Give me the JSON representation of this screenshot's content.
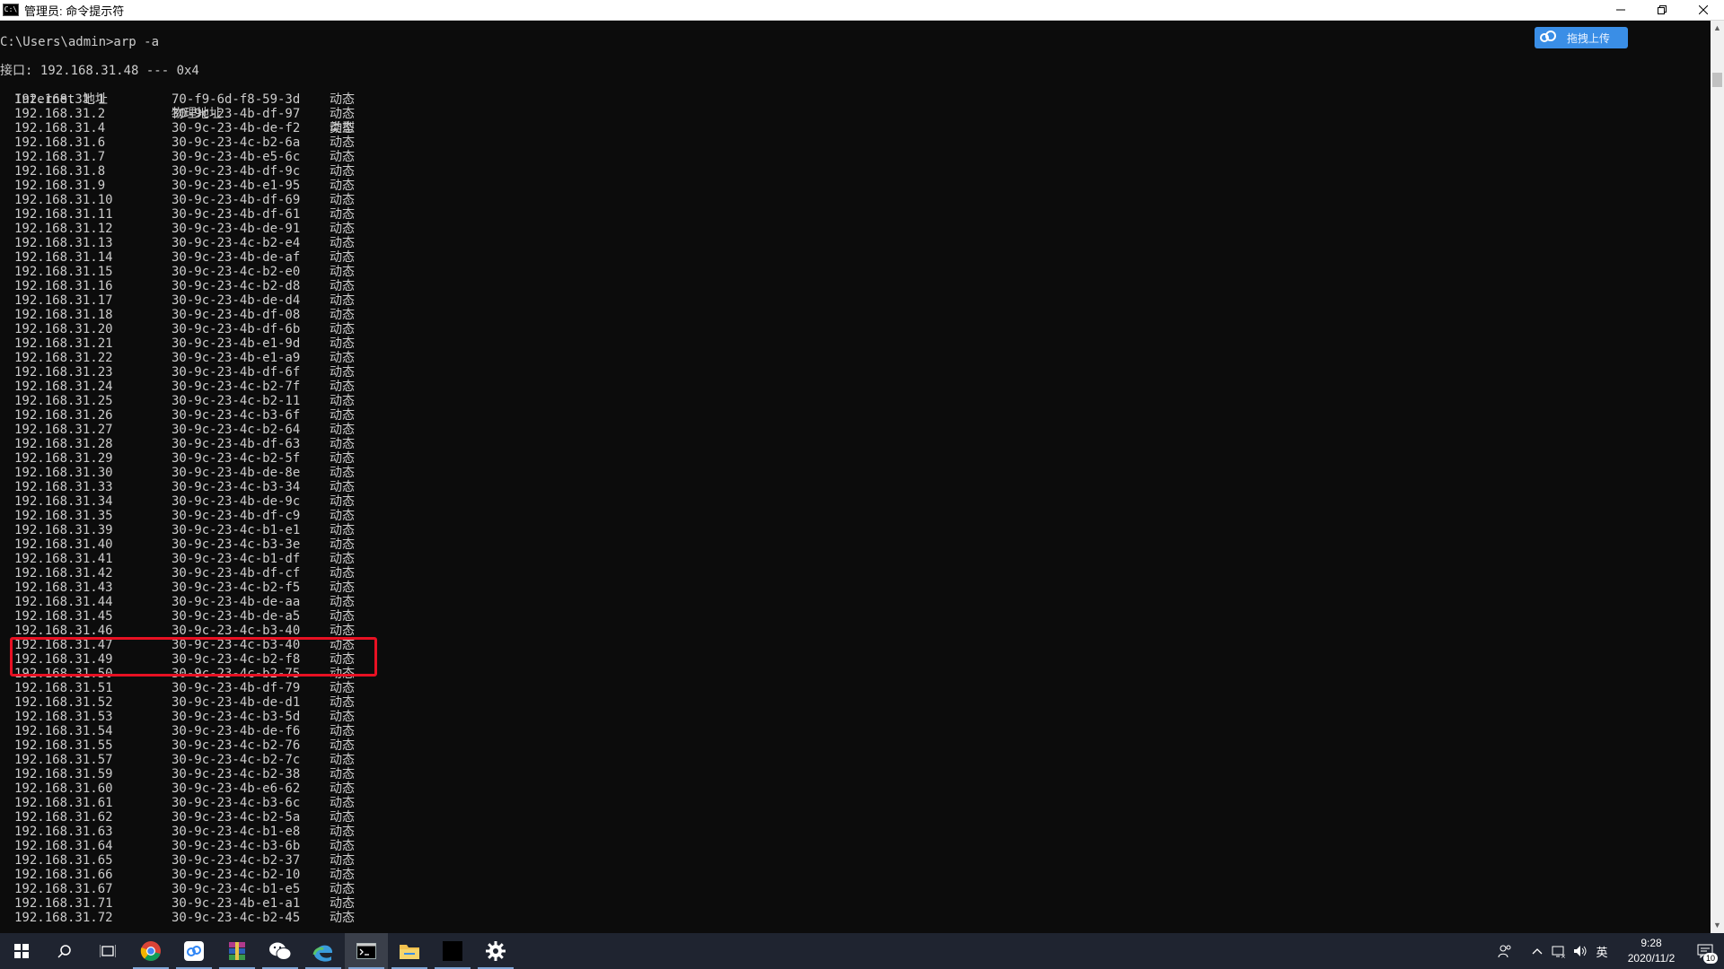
{
  "window": {
    "title": "管理员: 命令提示符",
    "app_icon_text": "C:\\"
  },
  "console": {
    "prompt": "C:\\Users\\admin>arp -a",
    "interface_line": "接口: 192.168.31.48 --- 0x4",
    "headers": [
      "Internet 地址",
      "物理地址",
      "类型"
    ],
    "rows": [
      {
        "ip": "192.168.31.1",
        "mac": "70-f9-6d-f8-59-3d",
        "type": "动态"
      },
      {
        "ip": "192.168.31.2",
        "mac": "30-9c-23-4b-df-97",
        "type": "动态"
      },
      {
        "ip": "192.168.31.4",
        "mac": "30-9c-23-4b-de-f2",
        "type": "动态"
      },
      {
        "ip": "192.168.31.6",
        "mac": "30-9c-23-4c-b2-6a",
        "type": "动态"
      },
      {
        "ip": "192.168.31.7",
        "mac": "30-9c-23-4b-e5-6c",
        "type": "动态"
      },
      {
        "ip": "192.168.31.8",
        "mac": "30-9c-23-4b-df-9c",
        "type": "动态"
      },
      {
        "ip": "192.168.31.9",
        "mac": "30-9c-23-4b-e1-95",
        "type": "动态"
      },
      {
        "ip": "192.168.31.10",
        "mac": "30-9c-23-4b-df-69",
        "type": "动态"
      },
      {
        "ip": "192.168.31.11",
        "mac": "30-9c-23-4b-df-61",
        "type": "动态"
      },
      {
        "ip": "192.168.31.12",
        "mac": "30-9c-23-4b-de-91",
        "type": "动态"
      },
      {
        "ip": "192.168.31.13",
        "mac": "30-9c-23-4c-b2-e4",
        "type": "动态"
      },
      {
        "ip": "192.168.31.14",
        "mac": "30-9c-23-4b-de-af",
        "type": "动态"
      },
      {
        "ip": "192.168.31.15",
        "mac": "30-9c-23-4c-b2-e0",
        "type": "动态"
      },
      {
        "ip": "192.168.31.16",
        "mac": "30-9c-23-4c-b2-d8",
        "type": "动态"
      },
      {
        "ip": "192.168.31.17",
        "mac": "30-9c-23-4b-de-d4",
        "type": "动态"
      },
      {
        "ip": "192.168.31.18",
        "mac": "30-9c-23-4b-df-08",
        "type": "动态"
      },
      {
        "ip": "192.168.31.20",
        "mac": "30-9c-23-4b-df-6b",
        "type": "动态"
      },
      {
        "ip": "192.168.31.21",
        "mac": "30-9c-23-4b-e1-9d",
        "type": "动态"
      },
      {
        "ip": "192.168.31.22",
        "mac": "30-9c-23-4b-e1-a9",
        "type": "动态"
      },
      {
        "ip": "192.168.31.23",
        "mac": "30-9c-23-4b-df-6f",
        "type": "动态"
      },
      {
        "ip": "192.168.31.24",
        "mac": "30-9c-23-4c-b2-7f",
        "type": "动态"
      },
      {
        "ip": "192.168.31.25",
        "mac": "30-9c-23-4c-b2-11",
        "type": "动态"
      },
      {
        "ip": "192.168.31.26",
        "mac": "30-9c-23-4c-b3-6f",
        "type": "动态"
      },
      {
        "ip": "192.168.31.27",
        "mac": "30-9c-23-4c-b2-64",
        "type": "动态"
      },
      {
        "ip": "192.168.31.28",
        "mac": "30-9c-23-4b-df-63",
        "type": "动态"
      },
      {
        "ip": "192.168.31.29",
        "mac": "30-9c-23-4c-b2-5f",
        "type": "动态"
      },
      {
        "ip": "192.168.31.30",
        "mac": "30-9c-23-4b-de-8e",
        "type": "动态"
      },
      {
        "ip": "192.168.31.33",
        "mac": "30-9c-23-4c-b3-34",
        "type": "动态"
      },
      {
        "ip": "192.168.31.34",
        "mac": "30-9c-23-4b-de-9c",
        "type": "动态"
      },
      {
        "ip": "192.168.31.35",
        "mac": "30-9c-23-4b-df-c9",
        "type": "动态"
      },
      {
        "ip": "192.168.31.39",
        "mac": "30-9c-23-4c-b1-e1",
        "type": "动态"
      },
      {
        "ip": "192.168.31.40",
        "mac": "30-9c-23-4c-b3-3e",
        "type": "动态"
      },
      {
        "ip": "192.168.31.41",
        "mac": "30-9c-23-4c-b1-df",
        "type": "动态"
      },
      {
        "ip": "192.168.31.42",
        "mac": "30-9c-23-4b-df-cf",
        "type": "动态"
      },
      {
        "ip": "192.168.31.43",
        "mac": "30-9c-23-4c-b2-f5",
        "type": "动态"
      },
      {
        "ip": "192.168.31.44",
        "mac": "30-9c-23-4b-de-aa",
        "type": "动态"
      },
      {
        "ip": "192.168.31.45",
        "mac": "30-9c-23-4b-de-a5",
        "type": "动态"
      },
      {
        "ip": "192.168.31.46",
        "mac": "30-9c-23-4c-b3-40",
        "type": "动态"
      },
      {
        "ip": "192.168.31.47",
        "mac": "30-9c-23-4c-b3-40",
        "type": "动态"
      },
      {
        "ip": "192.168.31.49",
        "mac": "30-9c-23-4c-b2-f8",
        "type": "动态"
      },
      {
        "ip": "192.168.31.50",
        "mac": "30-9c-23-4c-b2-75",
        "type": "动态"
      },
      {
        "ip": "192.168.31.51",
        "mac": "30-9c-23-4b-df-79",
        "type": "动态"
      },
      {
        "ip": "192.168.31.52",
        "mac": "30-9c-23-4b-de-d1",
        "type": "动态"
      },
      {
        "ip": "192.168.31.53",
        "mac": "30-9c-23-4c-b3-5d",
        "type": "动态"
      },
      {
        "ip": "192.168.31.54",
        "mac": "30-9c-23-4b-de-f6",
        "type": "动态"
      },
      {
        "ip": "192.168.31.55",
        "mac": "30-9c-23-4c-b2-76",
        "type": "动态"
      },
      {
        "ip": "192.168.31.57",
        "mac": "30-9c-23-4c-b2-7c",
        "type": "动态"
      },
      {
        "ip": "192.168.31.59",
        "mac": "30-9c-23-4c-b2-38",
        "type": "动态"
      },
      {
        "ip": "192.168.31.60",
        "mac": "30-9c-23-4b-e6-62",
        "type": "动态"
      },
      {
        "ip": "192.168.31.61",
        "mac": "30-9c-23-4c-b3-6c",
        "type": "动态"
      },
      {
        "ip": "192.168.31.62",
        "mac": "30-9c-23-4c-b2-5a",
        "type": "动态"
      },
      {
        "ip": "192.168.31.63",
        "mac": "30-9c-23-4c-b1-e8",
        "type": "动态"
      },
      {
        "ip": "192.168.31.64",
        "mac": "30-9c-23-4c-b3-6b",
        "type": "动态"
      },
      {
        "ip": "192.168.31.65",
        "mac": "30-9c-23-4c-b2-37",
        "type": "动态"
      },
      {
        "ip": "192.168.31.66",
        "mac": "30-9c-23-4c-b2-10",
        "type": "动态"
      },
      {
        "ip": "192.168.31.67",
        "mac": "30-9c-23-4c-b1-e5",
        "type": "动态"
      },
      {
        "ip": "192.168.31.71",
        "mac": "30-9c-23-4b-e1-a1",
        "type": "动态"
      },
      {
        "ip": "192.168.31.72",
        "mac": "30-9c-23-4c-b2-45",
        "type": "动态"
      }
    ],
    "highlighted_ips": [
      "192.168.31.46",
      "192.168.31.47"
    ]
  },
  "upload_widget": {
    "label": "拖拽上传",
    "icon": "cloud-icon"
  },
  "taskbar": {
    "items": [
      {
        "name": "start-button",
        "icon": "windows-logo-icon"
      },
      {
        "name": "search-button",
        "icon": "search-icon"
      },
      {
        "name": "task-view-button",
        "icon": "task-view-icon"
      },
      {
        "name": "chrome-app",
        "icon": "chrome-icon"
      },
      {
        "name": "baidu-netdisk-app",
        "icon": "netdisk-icon"
      },
      {
        "name": "winrar-app",
        "icon": "winrar-icon"
      },
      {
        "name": "wechat-app",
        "icon": "wechat-icon"
      },
      {
        "name": "edge-app",
        "icon": "edge-icon"
      },
      {
        "name": "cmd-app",
        "icon": "cmd-icon"
      },
      {
        "name": "file-explorer-app",
        "icon": "folder-icon"
      },
      {
        "name": "black-window-app",
        "icon": "blank-window-icon"
      },
      {
        "name": "settings-app",
        "icon": "gear-icon"
      }
    ],
    "tray": {
      "ime_label": "英",
      "time": "9:28",
      "date": "2020/11/2",
      "notification_count": "10"
    }
  }
}
